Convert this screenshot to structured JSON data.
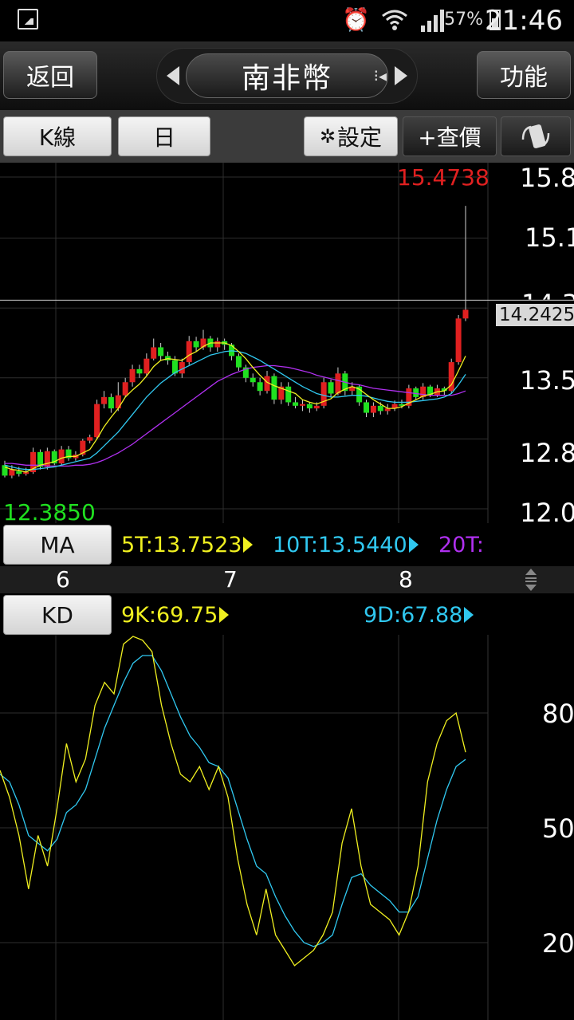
{
  "status_bar": {
    "time": "21:46",
    "battery": "57%",
    "icons": [
      "gallery-icon",
      "alarm-icon",
      "wifi-icon",
      "signal-icon",
      "battery-icon"
    ]
  },
  "header": {
    "back_label": "返回",
    "title": "南非幣",
    "function_label": "功能"
  },
  "toolbar": {
    "chart_type": "K線",
    "period": "日",
    "settings_label": "設定",
    "quote_label": "+查價"
  },
  "price_panel": {
    "high_label": "15.4738",
    "low_label": "12.3850",
    "current_price": "14.2425",
    "y_ticks": [
      "15.8",
      "15.1",
      "14.3",
      "13.5",
      "12.8",
      "12.0"
    ]
  },
  "ma_legend": {
    "button_label": "MA",
    "items": [
      {
        "label": "5T:13.7523",
        "color": "#f0f020"
      },
      {
        "label": "10T:13.5440",
        "color": "#30c8f0"
      },
      {
        "label": "20T:",
        "color": "#b030f0"
      }
    ]
  },
  "x_axis": {
    "labels": [
      "6",
      "7",
      "8"
    ]
  },
  "kd_legend": {
    "button_label": "KD",
    "k_label": "9K:69.75",
    "d_label": "9D:67.88",
    "k_color": "#f0f020",
    "d_color": "#30c8f0",
    "y_ticks": [
      "80",
      "50",
      "20"
    ]
  },
  "colors": {
    "up": "#e02020",
    "down": "#20e020"
  },
  "chart_data": [
    {
      "type": "candlestick",
      "ylim": [
        12.0,
        15.8
      ],
      "candles": [
        [
          12.5,
          12.38,
          12.55,
          12.36
        ],
        [
          12.38,
          12.45,
          12.5,
          12.35
        ],
        [
          12.43,
          12.4,
          12.48,
          12.37
        ],
        [
          12.4,
          12.42,
          12.47,
          12.38
        ],
        [
          12.42,
          12.65,
          12.7,
          12.4
        ],
        [
          12.65,
          12.48,
          12.68,
          12.45
        ],
        [
          12.48,
          12.66,
          12.7,
          12.45
        ],
        [
          12.66,
          12.52,
          12.68,
          12.5
        ],
        [
          12.52,
          12.68,
          12.72,
          12.5
        ],
        [
          12.68,
          12.58,
          12.72,
          12.55
        ],
        [
          12.58,
          12.62,
          12.66,
          12.55
        ],
        [
          12.62,
          12.78,
          12.8,
          12.6
        ],
        [
          12.78,
          12.82,
          12.85,
          12.75
        ],
        [
          12.82,
          13.2,
          13.25,
          12.8
        ],
        [
          13.2,
          13.28,
          13.35,
          13.15
        ],
        [
          13.28,
          13.15,
          13.32,
          13.1
        ],
        [
          13.15,
          13.3,
          13.45,
          13.12
        ],
        [
          13.3,
          13.45,
          13.5,
          13.28
        ],
        [
          13.45,
          13.6,
          13.65,
          13.4
        ],
        [
          13.6,
          13.55,
          13.65,
          13.5
        ],
        [
          13.55,
          13.72,
          13.78,
          13.52
        ],
        [
          13.72,
          13.85,
          13.95,
          13.7
        ],
        [
          13.85,
          13.75,
          13.9,
          13.7
        ],
        [
          13.75,
          13.7,
          13.8,
          13.65
        ],
        [
          13.7,
          13.55,
          13.75,
          13.52
        ],
        [
          13.55,
          13.68,
          13.72,
          13.5
        ],
        [
          13.68,
          13.92,
          13.98,
          13.65
        ],
        [
          13.92,
          13.85,
          13.97,
          13.8
        ],
        [
          13.85,
          13.95,
          14.05,
          13.82
        ],
        [
          13.95,
          13.85,
          13.98,
          13.8
        ],
        [
          13.85,
          13.92,
          13.96,
          13.8
        ],
        [
          13.92,
          13.88,
          13.95,
          13.82
        ],
        [
          13.88,
          13.75,
          13.9,
          13.7
        ],
        [
          13.75,
          13.62,
          13.78,
          13.58
        ],
        [
          13.62,
          13.5,
          13.65,
          13.45
        ],
        [
          13.5,
          13.45,
          13.55,
          13.4
        ],
        [
          13.45,
          13.35,
          13.5,
          13.3
        ],
        [
          13.35,
          13.52,
          13.58,
          13.32
        ],
        [
          13.52,
          13.25,
          13.55,
          13.2
        ],
        [
          13.25,
          13.4,
          13.45,
          13.2
        ],
        [
          13.4,
          13.22,
          13.45,
          13.18
        ],
        [
          13.22,
          13.18,
          13.28,
          13.15
        ],
        [
          13.18,
          13.2,
          13.25,
          13.12
        ],
        [
          13.2,
          13.15,
          13.22,
          13.1
        ],
        [
          13.15,
          13.18,
          13.22,
          13.12
        ],
        [
          13.18,
          13.45,
          13.5,
          13.15
        ],
        [
          13.45,
          13.32,
          13.48,
          13.28
        ],
        [
          13.32,
          13.55,
          13.62,
          13.3
        ],
        [
          13.55,
          13.35,
          13.58,
          13.3
        ],
        [
          13.35,
          13.4,
          13.45,
          13.3
        ],
        [
          13.4,
          13.22,
          13.42,
          13.18
        ],
        [
          13.22,
          13.1,
          13.25,
          13.05
        ],
        [
          13.1,
          13.18,
          13.22,
          13.05
        ],
        [
          13.18,
          13.12,
          13.22,
          13.08
        ],
        [
          13.12,
          13.15,
          13.2,
          13.08
        ],
        [
          13.15,
          13.2,
          13.24,
          13.12
        ],
        [
          13.2,
          13.18,
          13.25,
          13.15
        ],
        [
          13.18,
          13.38,
          13.42,
          13.15
        ],
        [
          13.38,
          13.28,
          13.4,
          13.25
        ],
        [
          13.28,
          13.4,
          13.44,
          13.25
        ],
        [
          13.4,
          13.3,
          13.42,
          13.28
        ],
        [
          13.3,
          13.38,
          13.42,
          13.28
        ],
        [
          13.38,
          13.35,
          13.4,
          13.3
        ],
        [
          13.35,
          13.68,
          13.72,
          13.32
        ],
        [
          13.68,
          14.18,
          14.22,
          13.65
        ],
        [
          14.18,
          14.28,
          15.47,
          14.15
        ]
      ],
      "ma5": [
        12.48,
        12.45,
        12.44,
        12.42,
        12.46,
        12.5,
        12.52,
        12.54,
        12.58,
        12.6,
        12.6,
        12.64,
        12.68,
        12.8,
        12.94,
        13.05,
        13.15,
        13.28,
        13.36,
        13.43,
        13.52,
        13.63,
        13.7,
        13.72,
        13.71,
        13.7,
        13.76,
        13.8,
        13.86,
        13.9,
        13.9,
        13.9,
        13.87,
        13.8,
        13.72,
        13.62,
        13.53,
        13.45,
        13.41,
        13.38,
        13.35,
        13.32,
        13.25,
        13.22,
        13.2,
        13.23,
        13.26,
        13.33,
        13.37,
        13.4,
        13.37,
        13.31,
        13.25,
        13.2,
        13.15,
        13.15,
        13.17,
        13.21,
        13.25,
        13.29,
        13.31,
        13.34,
        13.35,
        13.42,
        13.58,
        13.75
      ],
      "ma10": [
        12.5,
        12.48,
        12.46,
        12.45,
        12.45,
        12.46,
        12.47,
        12.48,
        12.5,
        12.52,
        12.54,
        12.56,
        12.58,
        12.64,
        12.72,
        12.8,
        12.88,
        12.98,
        13.08,
        13.18,
        13.28,
        13.36,
        13.44,
        13.5,
        13.56,
        13.6,
        13.64,
        13.68,
        13.72,
        13.76,
        13.78,
        13.8,
        13.81,
        13.8,
        13.78,
        13.74,
        13.7,
        13.65,
        13.6,
        13.55,
        13.5,
        13.45,
        13.4,
        13.36,
        13.32,
        13.3,
        13.28,
        13.28,
        13.29,
        13.3,
        13.3,
        13.29,
        13.27,
        13.25,
        13.23,
        13.22,
        13.22,
        13.22,
        13.23,
        13.24,
        13.25,
        13.26,
        13.28,
        13.32,
        13.42,
        13.54
      ],
      "ma20": [
        12.52,
        12.52,
        12.51,
        12.5,
        12.5,
        12.5,
        12.49,
        12.49,
        12.49,
        12.49,
        12.5,
        12.5,
        12.51,
        12.53,
        12.56,
        12.6,
        12.64,
        12.69,
        12.74,
        12.8,
        12.86,
        12.92,
        12.98,
        13.04,
        13.1,
        13.16,
        13.22,
        13.28,
        13.34,
        13.4,
        13.46,
        13.5,
        13.54,
        13.57,
        13.6,
        13.62,
        13.63,
        13.64,
        13.64,
        13.63,
        13.62,
        13.6,
        13.58,
        13.56,
        13.53,
        13.51,
        13.49,
        13.47,
        13.45,
        13.43,
        13.42,
        13.4,
        13.38,
        13.37,
        13.36,
        13.35,
        13.34,
        13.33,
        13.32,
        13.31,
        13.3,
        13.3,
        13.3,
        13.3,
        13.32,
        13.35
      ]
    },
    {
      "type": "line",
      "ylim": [
        0,
        100
      ],
      "series": [
        {
          "name": "9K",
          "values": [
            65,
            58,
            48,
            34,
            48,
            40,
            55,
            72,
            62,
            68,
            82,
            88,
            85,
            98,
            100,
            99,
            96,
            82,
            72,
            64,
            62,
            66,
            60,
            66,
            58,
            42,
            30,
            22,
            34,
            22,
            18,
            14,
            16,
            18,
            22,
            28,
            46,
            55,
            40,
            30,
            28,
            26,
            22,
            28,
            40,
            62,
            72,
            78,
            80,
            69.75
          ]
        },
        {
          "name": "9D",
          "values": [
            64,
            62,
            56,
            48,
            46,
            44,
            47,
            54,
            56,
            60,
            68,
            76,
            82,
            88,
            93,
            95,
            95,
            91,
            85,
            79,
            74,
            71,
            67,
            66,
            63,
            55,
            47,
            40,
            38,
            32,
            27,
            23,
            20,
            19,
            20,
            22,
            30,
            37,
            38,
            35,
            33,
            31,
            28,
            28,
            32,
            42,
            52,
            60,
            66,
            67.88
          ]
        }
      ]
    }
  ]
}
